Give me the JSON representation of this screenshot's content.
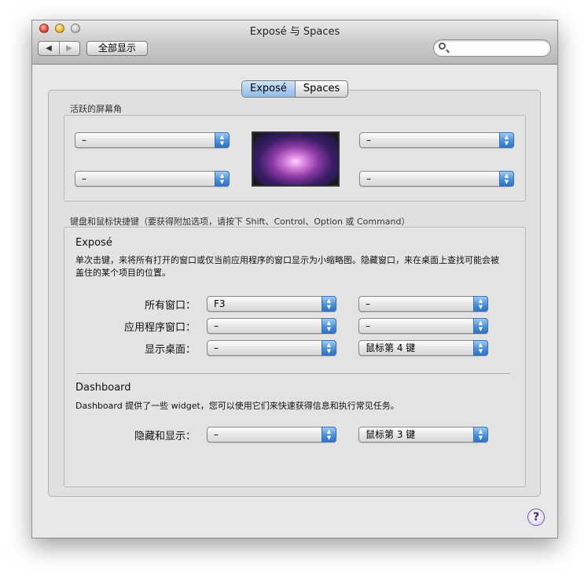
{
  "window": {
    "title": "Exposé 与 Spaces"
  },
  "toolbar": {
    "back_icon": "◀",
    "forward_icon": "▶",
    "show_all_label": "全部显示",
    "search_placeholder": ""
  },
  "tabs": [
    {
      "label": "Exposé",
      "selected": true
    },
    {
      "label": "Spaces",
      "selected": false
    }
  ],
  "hot_corners": {
    "label": "活跃的屏幕角",
    "top_left": "–",
    "bottom_left": "–",
    "top_right": "–",
    "bottom_right": "–"
  },
  "shortcuts": {
    "label": "键盘和鼠标快捷键（要获得附加选项，请按下 Shift、Control、Option 或 Command）",
    "expose_heading": "Exposé",
    "expose_desc_line1": "单次击键，来将所有打开的窗口或仅当前应用程序的窗口显示为小缩略图。隐藏窗口，来在桌面上查找可能会被",
    "expose_desc_line2": "盖住的某个项目的位置。",
    "rows": [
      {
        "label": "所有窗口：",
        "key": "F3",
        "mouse": "–"
      },
      {
        "label": "应用程序窗口：",
        "key": "–",
        "mouse": "–"
      },
      {
        "label": "显示桌面：",
        "key": "–",
        "mouse": "鼠标第 4 键"
      }
    ],
    "dashboard_heading": "Dashboard",
    "dashboard_desc": "Dashboard 提供了一些 widget，您可以使用它们来快速获得信息和执行常见任务。",
    "dashboard_row": {
      "label": "隐藏和显示：",
      "key": "–",
      "mouse": "鼠标第 3 键"
    }
  },
  "help": {
    "label": "?"
  }
}
